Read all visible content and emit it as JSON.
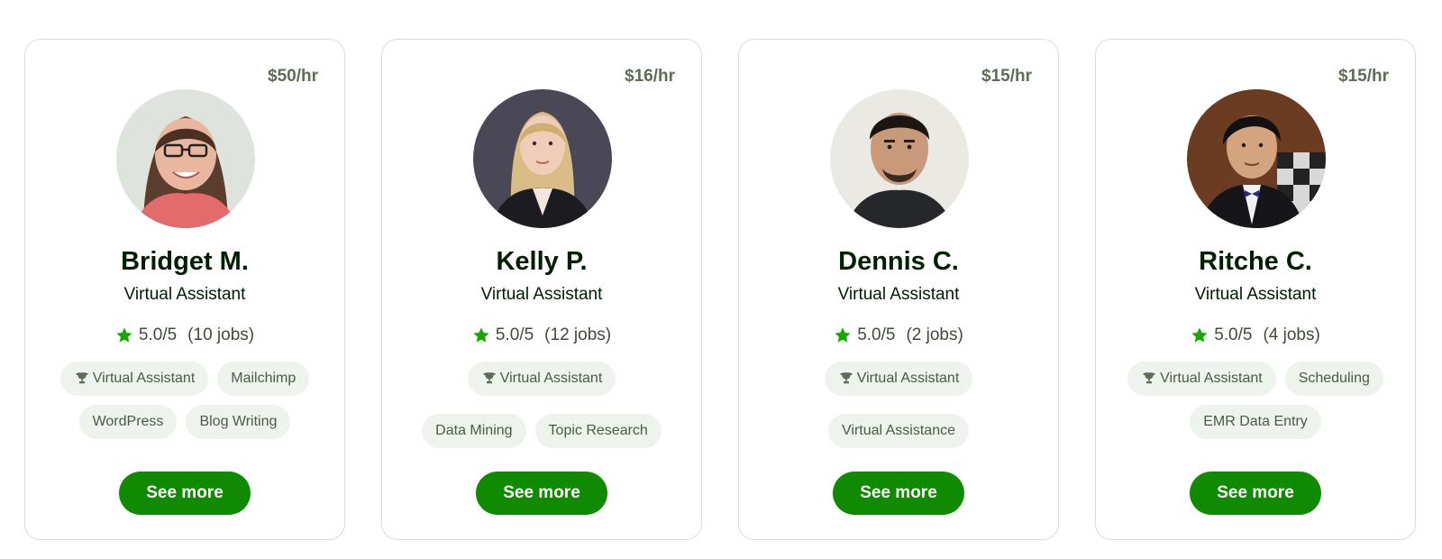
{
  "accent_color": "#108a00",
  "freelancers": [
    {
      "rate": "$50/hr",
      "name": "Bridget M.",
      "title": "Virtual Assistant",
      "rating": "5.0/5",
      "jobs": "(10 jobs)",
      "skills": [
        "Virtual Assistant",
        "Mailchimp",
        "WordPress",
        "Blog Writing"
      ],
      "button": "See more"
    },
    {
      "rate": "$16/hr",
      "name": "Kelly P.",
      "title": "Virtual Assistant",
      "rating": "5.0/5",
      "jobs": "(12 jobs)",
      "skills": [
        "Virtual Assistant",
        "Data Mining",
        "Topic Research"
      ],
      "button": "See more"
    },
    {
      "rate": "$15/hr",
      "name": "Dennis C.",
      "title": "Virtual Assistant",
      "rating": "5.0/5",
      "jobs": "(2 jobs)",
      "skills": [
        "Virtual Assistant",
        "Virtual Assistance"
      ],
      "button": "See more"
    },
    {
      "rate": "$15/hr",
      "name": "Ritche C.",
      "title": "Virtual Assistant",
      "rating": "5.0/5",
      "jobs": "(4 jobs)",
      "skills": [
        "Virtual Assistant",
        "Scheduling",
        "EMR Data Entry"
      ],
      "button": "See more"
    }
  ]
}
